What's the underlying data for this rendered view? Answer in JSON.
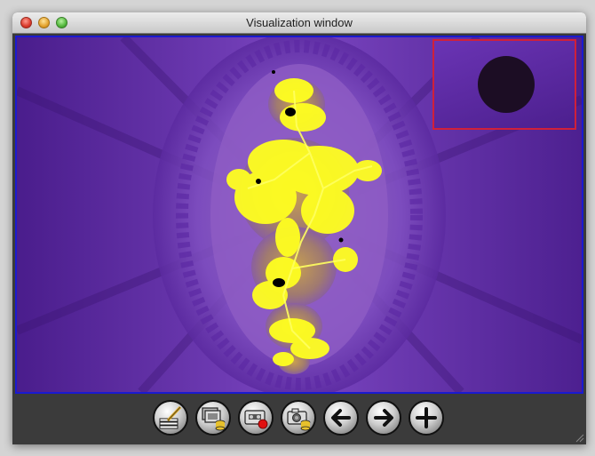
{
  "window": {
    "title": "Visualization window"
  },
  "viewport": {
    "background_color": "#5a2aa0",
    "fractal_color": "#ffff20",
    "minimap_border_color": "#d0203a"
  },
  "toolbar": {
    "buttons": [
      {
        "name": "draw-tool-button",
        "icon": "pencil-on-paper-icon"
      },
      {
        "name": "save-image-button",
        "icon": "stack-with-database-icon"
      },
      {
        "name": "record-movie-button",
        "icon": "tape-with-record-icon"
      },
      {
        "name": "camera-save-button",
        "icon": "camera-with-database-icon"
      },
      {
        "name": "back-button",
        "icon": "arrow-left-icon"
      },
      {
        "name": "forward-button",
        "icon": "arrow-right-icon"
      },
      {
        "name": "zoom-in-button",
        "icon": "plus-icon"
      }
    ]
  }
}
